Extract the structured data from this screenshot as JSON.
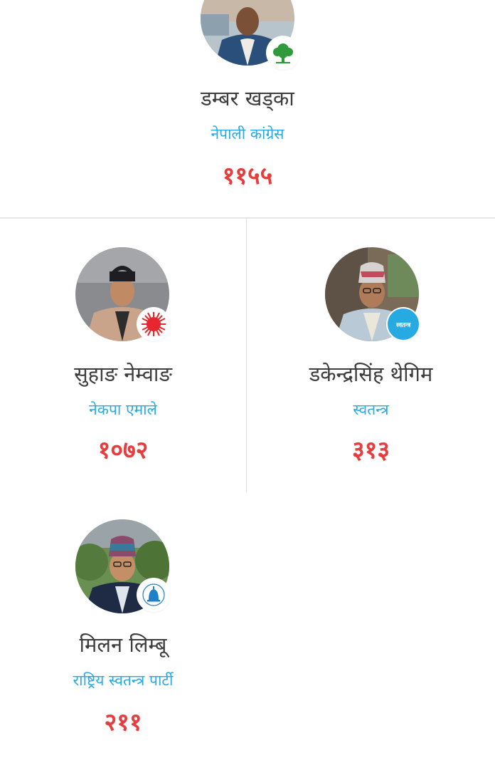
{
  "candidates": [
    {
      "name": "डम्बर खड्का",
      "party": "नेपाली कांग्रेस",
      "votes": "११५५",
      "party_symbol": "tree-icon",
      "party_color": "#2e9a3a"
    },
    {
      "name": "सुहाङ नेम्वाङ",
      "party": "नेकपा एमाले",
      "votes": "१०७२",
      "party_symbol": "sun-icon",
      "party_color": "#e8262e"
    },
    {
      "name": "डकेन्द्रसिंह थेगिम",
      "party": "स्वतन्त्र",
      "votes": "३१३",
      "party_symbol": "independent-badge",
      "party_color": "#27a9e1",
      "badge_text": "स्वतन्त्र"
    },
    {
      "name": "मिलन लिम्बू",
      "party": "राष्ट्रिय स्वतन्त्र पार्टी",
      "votes": "२११",
      "party_symbol": "bell-icon",
      "party_color": "#1f7fc7"
    }
  ],
  "colors": {
    "name_text": "#3d3d3d",
    "party_text": "#27a9e1",
    "votes_text": "#e53e3e",
    "divider": "#e6e6e6"
  }
}
